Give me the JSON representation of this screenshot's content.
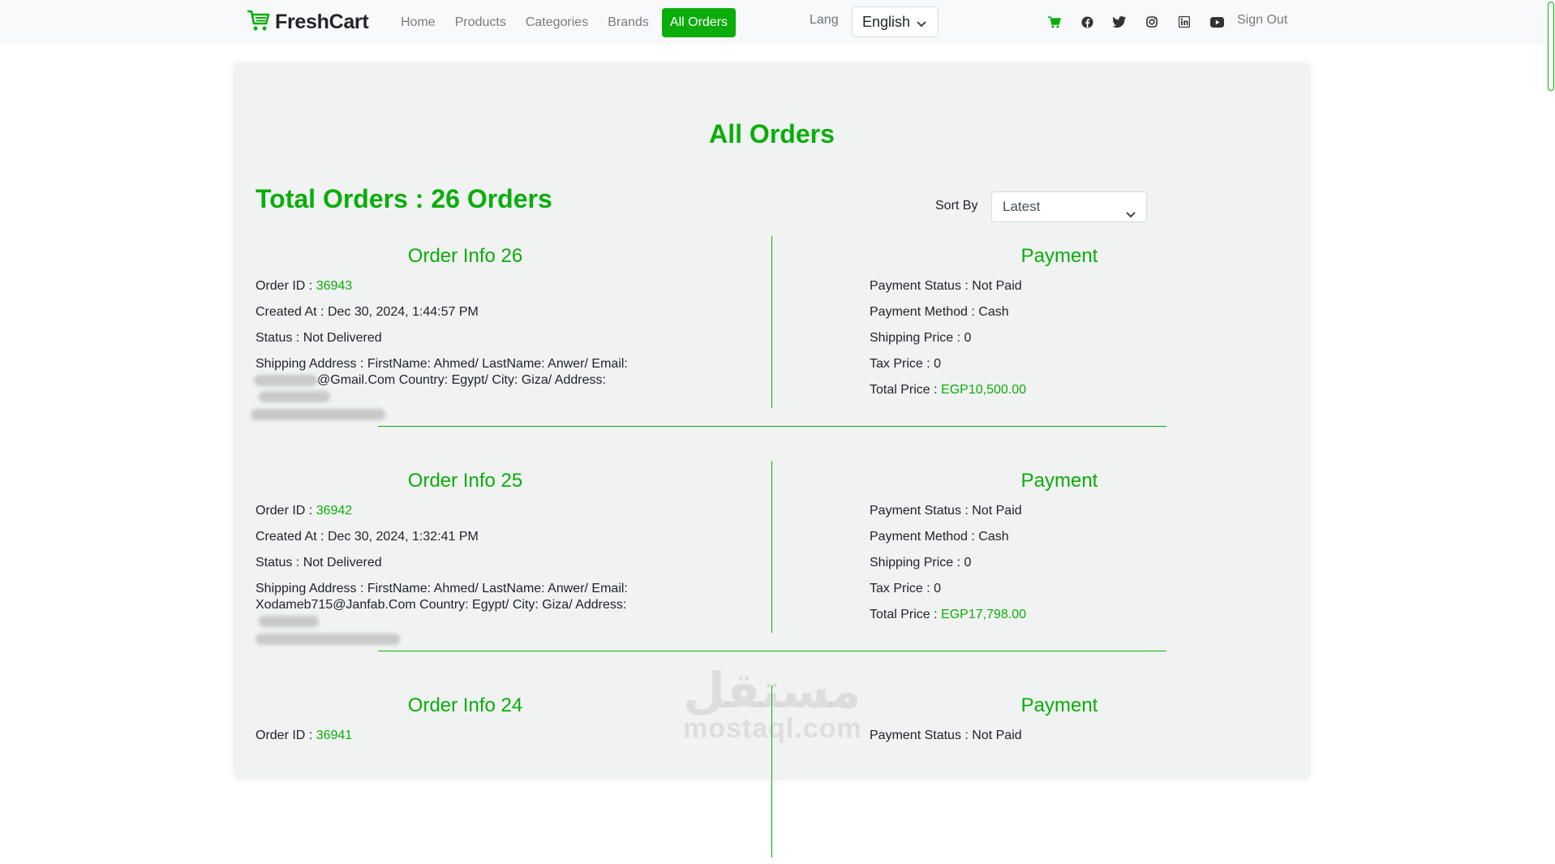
{
  "navbar": {
    "brand": "FreshCart",
    "links": [
      {
        "label": "Home"
      },
      {
        "label": "Products"
      },
      {
        "label": "Categories"
      },
      {
        "label": "Brands"
      },
      {
        "label": "All Orders"
      }
    ],
    "lang_label": "Lang",
    "lang_selected": "English",
    "social_icons": [
      "cart-icon",
      "facebook-icon",
      "twitter-icon",
      "instagram-icon",
      "linkedin-icon",
      "youtube-icon"
    ],
    "sign_out": "Sign Out"
  },
  "page": {
    "title": "All Orders",
    "total": "Total Orders : 26 Orders",
    "sort_label": "Sort By",
    "sort_selected": "Latest"
  },
  "colors": {
    "accent": "#0aad0a",
    "card_bg": "#f0f3f2"
  },
  "orders": [
    {
      "title": "Order Info 26",
      "id_label": "Order ID : ",
      "id": "36943",
      "created": "Created At : Dec 30, 2024, 1:44:57 PM",
      "status": "Status : Not Delivered",
      "shipping_line1": "Shipping Address : FirstName: Ahmed/ LastName: Anwer/ Email:",
      "shipping_line2": "@Gmail.Com Country: Egypt/ City: Giza/ Address:",
      "payment_title": "Payment",
      "payment_status": "Payment Status : Not Paid",
      "payment_method": "Payment Method : Cash",
      "shipping_price": "Shipping Price : 0",
      "tax_price": "Tax Price : 0",
      "total_label": "Total Price : ",
      "total": "EGP10,500.00"
    },
    {
      "title": "Order Info 25",
      "id_label": "Order ID : ",
      "id": "36942",
      "created": "Created At : Dec 30, 2024, 1:32:41 PM",
      "status": "Status : Not Delivered",
      "shipping_line1": "Shipping Address : FirstName: Ahmed/ LastName: Anwer/ Email:",
      "shipping_line2": "Xodameb715@Janfab.Com Country: Egypt/ City: Giza/ Address:",
      "payment_title": "Payment",
      "payment_status": "Payment Status : Not Paid",
      "payment_method": "Payment Method : Cash",
      "shipping_price": "Shipping Price : 0",
      "tax_price": "Tax Price : 0",
      "total_label": "Total Price : ",
      "total": "EGP17,798.00"
    },
    {
      "title": "Order Info 24",
      "id_label": "Order ID : ",
      "id": "36941",
      "payment_title": "Payment",
      "payment_status": "Payment Status : Not Paid"
    }
  ],
  "watermark": {
    "arabic": "مستقل",
    "latin": "mostaql.com"
  }
}
